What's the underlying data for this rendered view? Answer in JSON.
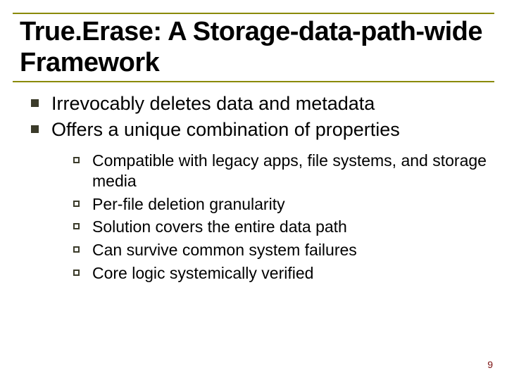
{
  "title": "True.Erase:  A Storage-data-path-wide Framework",
  "bullets_l1": [
    "Irrevocably deletes data and metadata",
    "Offers a unique combination of properties"
  ],
  "bullets_l2": [
    "Compatible with legacy apps, file systems, and storage media",
    "Per-file deletion granularity",
    "Solution covers the entire data path",
    "Can survive common system failures",
    "Core logic systemically verified"
  ],
  "page_number": "9"
}
